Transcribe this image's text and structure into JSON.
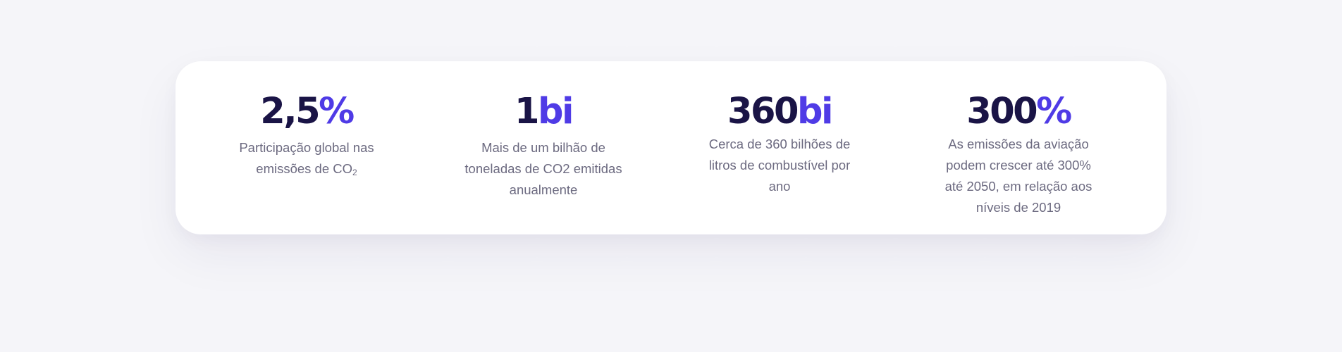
{
  "stats": [
    {
      "value": "2,5",
      "unit": "%",
      "desc": "Participação global nas emissões de CO",
      "desc_sub": "2"
    },
    {
      "value": "1",
      "unit": "bi",
      "desc": "Mais de um bilhão de toneladas de CO2 emitidas anualmente"
    },
    {
      "value": "360",
      "unit": "bi",
      "desc": "Cerca de 360 bilhões de litros de combustível por ano"
    },
    {
      "value": "300",
      "unit": "%",
      "desc": "As emissões da aviação podem crescer até 300% até 2050, em relação aos níveis de 2019"
    }
  ],
  "colors": {
    "background": "#f5f5f9",
    "card": "#ffffff",
    "number": "#1a1446",
    "accent": "#4f3be6",
    "text": "#6c6a80"
  }
}
